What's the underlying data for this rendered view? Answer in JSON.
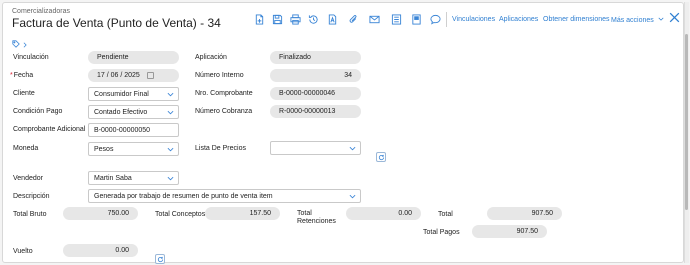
{
  "header": {
    "breadcrumb": "Comercializadoras",
    "title": "Factura de Venta (Punto de Venta) - 34"
  },
  "toolbar": {
    "icons": [
      "new-document-icon",
      "save-icon",
      "print-icon",
      "history-icon",
      "pdf-icon",
      "attach-icon",
      "email-icon",
      "list-icon",
      "notes-icon",
      "comment-icon"
    ],
    "links": {
      "vinculaciones": "Vinculaciones",
      "aplicaciones": "Aplicaciones",
      "dimensiones": "Obtener dimensiones",
      "mas_acciones": "Más acciones"
    }
  },
  "form": {
    "vinculacion": {
      "label": "Vinculación",
      "value": "Pendiente"
    },
    "aplicacion": {
      "label": "Aplicación",
      "value": "Finalizado"
    },
    "fecha": {
      "required": "*",
      "label": "Fecha",
      "value": "17 / 06 / 2025"
    },
    "numero_interno": {
      "label": "Número Interno",
      "value": "34"
    },
    "cliente": {
      "label": "Cliente",
      "value": "Consumidor Final"
    },
    "nro_comprobante": {
      "label": "Nro. Comprobante",
      "value": "B-0000-00000046"
    },
    "condicion_pago": {
      "label": "Condición Pago",
      "value": "Contado Efectivo"
    },
    "numero_cobranza": {
      "label": "Número Cobranza",
      "value": "R-0000-00000013"
    },
    "comprobante_adicional": {
      "label": "Comprobante Adicional",
      "value": "B-0000-00000050"
    },
    "moneda": {
      "label": "Moneda",
      "value": "Pesos"
    },
    "lista_precios": {
      "label": "Lista De Precios",
      "value": ""
    },
    "vendedor": {
      "label": "Vendedor",
      "value": "Martin Saba"
    },
    "descripcion": {
      "label": "Descripción",
      "value": "Generada por trabajo de resumen de punto de venta item"
    }
  },
  "totals": {
    "total_bruto": {
      "label": "Total Bruto",
      "value": "750.00"
    },
    "total_conceptos": {
      "label": "Total Conceptos",
      "value": "157.50"
    },
    "total_retenciones": {
      "label_1": "Total",
      "label_2": "Retenciones",
      "value": "0.00"
    },
    "total": {
      "label": "Total",
      "value": "907.50"
    },
    "total_pagos": {
      "label": "Total Pagos",
      "value": "907.50"
    },
    "vuelto": {
      "label": "Vuelto",
      "value": "0.00"
    }
  }
}
